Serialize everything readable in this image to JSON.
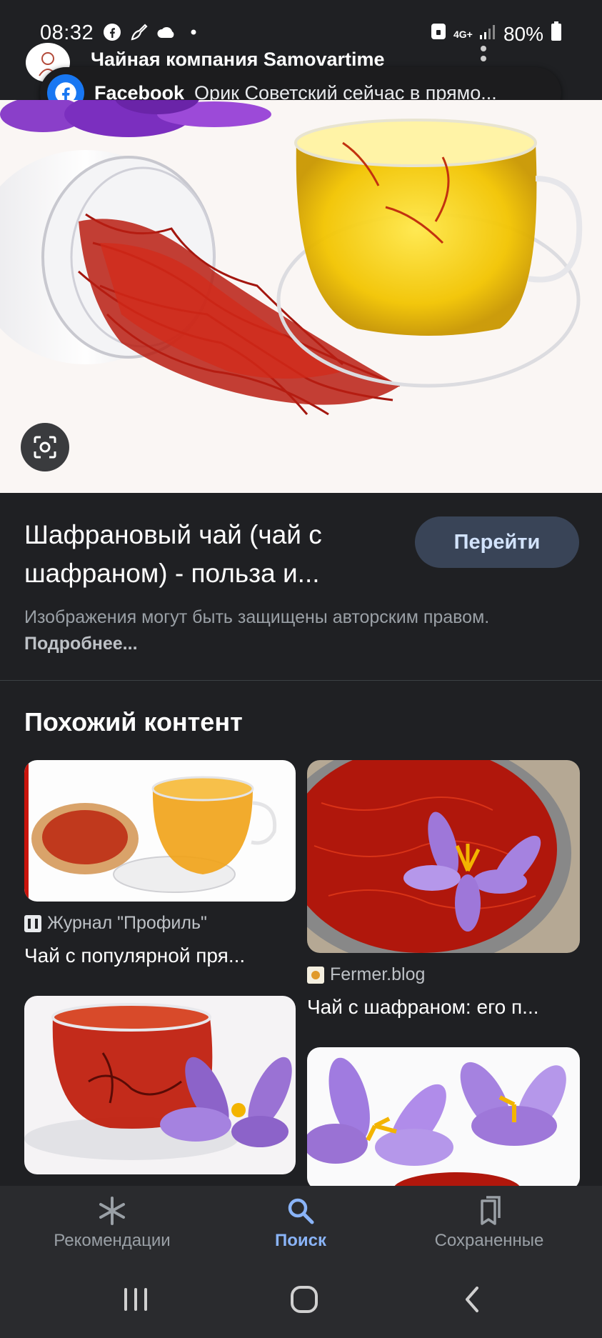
{
  "status_bar": {
    "time": "08:32",
    "battery": "80%",
    "network": "4G+"
  },
  "site_header": {
    "name": "Чайная компания Samovartime"
  },
  "notification": {
    "app": "Facebook",
    "message": "Орик Советский сейчас в прямо..."
  },
  "result": {
    "title": "Шафрановый чай (чай с шафраном) - польза и...",
    "go_label": "Перейти",
    "copyright_text": "Изображения могут быть защищены авторским правом.",
    "more_label": "Подробнее..."
  },
  "similar": {
    "heading": "Похожий контент",
    "cards": [
      {
        "source": "Журнал \"Профиль\"",
        "caption": "Чай с популярной пря..."
      },
      {
        "source": "Fermer.blog",
        "caption": "Чай с шафраном: его п..."
      }
    ]
  },
  "bottom_nav": {
    "items": [
      {
        "label": "Рекомендации",
        "icon": "asterisk-icon"
      },
      {
        "label": "Поиск",
        "icon": "search-icon"
      },
      {
        "label": "Сохраненные",
        "icon": "bookmarks-icon"
      }
    ]
  },
  "colors": {
    "background": "#1f2023",
    "accent": "#8ab4f8",
    "button_bg": "#394457",
    "facebook": "#1877f2"
  }
}
